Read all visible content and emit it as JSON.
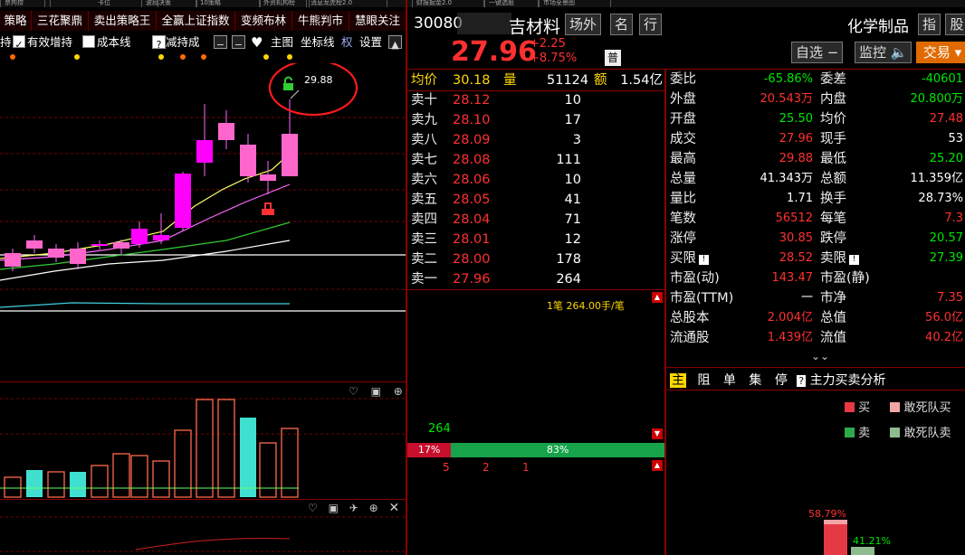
{
  "top_tabs_partial": [
    "票拘捞",
    "卡位",
    "波段决策",
    "10策略",
    "外资机构榜",
    "消息龙虎榜2.0",
    "财报掘金2.0",
    "一键选股",
    "市场全景图"
  ],
  "tabs": [
    "策略",
    "三花聚鼎",
    "卖出策略王",
    "全赢上证指数",
    "变频布林",
    "牛熊判市",
    "慧眼关注"
  ],
  "toolbar": {
    "hold_partial": "持",
    "effective_add": "有效增持",
    "cost_line": "成本线",
    "reduce_hold": "减持成",
    "main_chart": "主图",
    "coord_line": "坐标线",
    "quan": "权",
    "settings": "设置"
  },
  "chart": {
    "high_label": "29.88"
  },
  "stock": {
    "code": "30080",
    "name": "吉材料",
    "field_btn": "场外",
    "name_btn": "名",
    "industry_btn": "行",
    "industry": "化学制品",
    "index_btn": "指",
    "share_btn": "股",
    "price": "27.96",
    "change": "+2.25",
    "change_pct": "+8.75%",
    "pu": "普",
    "watch_btn": "自选",
    "monitor_btn": "监控",
    "trade_btn": "交易"
  },
  "avg_row": {
    "label1": "均价",
    "value1": "30.18",
    "label2": "量",
    "value2": "51124",
    "label3": "额",
    "value3": "1.54亿"
  },
  "order_book": [
    {
      "label": "卖十",
      "price": "28.12",
      "vol": "10"
    },
    {
      "label": "卖九",
      "price": "28.10",
      "vol": "17"
    },
    {
      "label": "卖八",
      "price": "28.09",
      "vol": "3"
    },
    {
      "label": "卖七",
      "price": "28.08",
      "vol": "111"
    },
    {
      "label": "卖六",
      "price": "28.06",
      "vol": "10"
    },
    {
      "label": "卖五",
      "price": "28.05",
      "vol": "41"
    },
    {
      "label": "卖四",
      "price": "28.04",
      "vol": "71"
    },
    {
      "label": "卖三",
      "price": "28.01",
      "vol": "12"
    },
    {
      "label": "卖二",
      "price": "28.00",
      "vol": "178"
    },
    {
      "label": "卖一",
      "price": "27.96",
      "vol": "264"
    }
  ],
  "order_detail": "1笔 264.00手/笔",
  "bar_number": "264",
  "ratio": {
    "left": "17%",
    "right": "83%"
  },
  "ticks": [
    "5",
    "2",
    "1"
  ],
  "stats": [
    {
      "l1": "委比",
      "v1": "-65.86%",
      "c1": "green",
      "l2": "委差",
      "v2": "-40601",
      "c2": "green"
    },
    {
      "l1": "外盘",
      "v1": "20.543万",
      "c1": "red",
      "l2": "内盘",
      "v2": "20.800万",
      "c2": "green"
    },
    {
      "l1": "开盘",
      "v1": "25.50",
      "c1": "green",
      "l2": "均价",
      "v2": "27.48",
      "c2": "red"
    },
    {
      "l1": "成交",
      "v1": "27.96",
      "c1": "red",
      "l2": "现手",
      "v2": "53",
      "c2": "white"
    },
    {
      "l1": "最高",
      "v1": "29.88",
      "c1": "red",
      "l2": "最低",
      "v2": "25.20",
      "c2": "green"
    },
    {
      "l1": "总量",
      "v1": "41.343万",
      "c1": "white",
      "l2": "总额",
      "v2": "11.359亿",
      "c2": "white"
    },
    {
      "l1": "量比",
      "v1": "1.71",
      "c1": "white",
      "l2": "换手",
      "v2": "28.73%",
      "c2": "white"
    },
    {
      "l1": "笔数",
      "v1": "56512",
      "c1": "red",
      "l2": "每笔",
      "v2": "7.3",
      "c2": "red"
    },
    {
      "l1": "涨停",
      "v1": "30.85",
      "c1": "red",
      "l2": "跌停",
      "v2": "20.57",
      "c2": "green"
    },
    {
      "l1": "买限",
      "v1": "28.52",
      "c1": "red",
      "l2": "卖限",
      "v2": "27.39",
      "c2": "green"
    },
    {
      "l1": "市盈(动)",
      "v1": "143.47",
      "c1": "red",
      "l2": "市盈(静)",
      "v2": "",
      "c2": "white"
    },
    {
      "l1": "市盈(TTM)",
      "v1": "一",
      "c1": "white",
      "l2": "市净",
      "v2": "7.35",
      "c2": "red"
    },
    {
      "l1": "总股本",
      "v1": "2.004亿",
      "c1": "red",
      "l2": "总值",
      "v2": "56.0亿",
      "c2": "red"
    },
    {
      "l1": "流通股",
      "v1": "1.439亿",
      "c1": "red",
      "l2": "流值",
      "v2": "40.2亿",
      "c2": "red"
    }
  ],
  "analysis_tabs": [
    "主",
    "阻",
    "单",
    "集",
    "停"
  ],
  "analysis_title": "主力买卖分析",
  "legend": {
    "buy": "买",
    "dead_buy": "敢死队买",
    "sell": "卖",
    "dead_sell": "敢死队卖"
  },
  "pct_left": "58.79%",
  "pct_right": "41.21%",
  "colors": {
    "up": "#ff00ff",
    "down": "#ff66cc",
    "vol_up": "#ff6a4d",
    "vol_down": "#40e0d0",
    "accent_red": "#ff3030",
    "green": "#00e600"
  }
}
